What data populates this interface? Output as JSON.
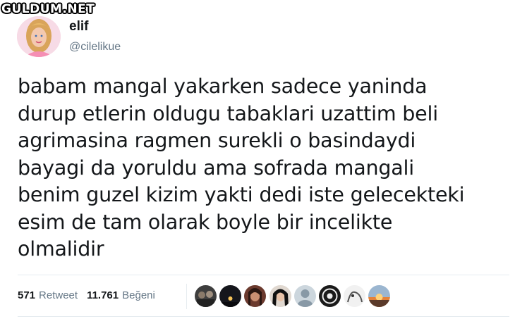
{
  "watermark": "GULDUM.NET",
  "user": {
    "name": "elif",
    "handle": "@cilelikue"
  },
  "tweet": {
    "text": "babam mangal yakarken sadece yaninda\ndurup etlerin oldugu tabaklari uzattim beli\nagrimasina ragmen surekli o basindaydi\nbayagi da yoruldu ama sofrada mangali\nbenim guzel kizim yakti dedi iste gelecekteki\nesim de tam olarak boyle bir incelikte\nolmalidir"
  },
  "stats": {
    "retweet_count": "571",
    "retweet_label": "Retweet",
    "like_count": "11.761",
    "like_label": "Beğeni"
  },
  "likers": [
    {
      "icon": "avatar-dark-group",
      "bg": "#4a4a4a"
    },
    {
      "icon": "avatar-night",
      "bg": "#1c1c22"
    },
    {
      "icon": "avatar-woman-dark",
      "bg": "#5a2f28"
    },
    {
      "icon": "avatar-woman-hair",
      "bg": "#2a2a2a"
    },
    {
      "icon": "avatar-default",
      "bg": "#b8c4cf"
    },
    {
      "icon": "avatar-badge",
      "bg": "#1a1a1a"
    },
    {
      "icon": "avatar-sketch",
      "bg": "#d9d9d9"
    },
    {
      "icon": "avatar-sunset",
      "bg": "#f0a050"
    }
  ]
}
